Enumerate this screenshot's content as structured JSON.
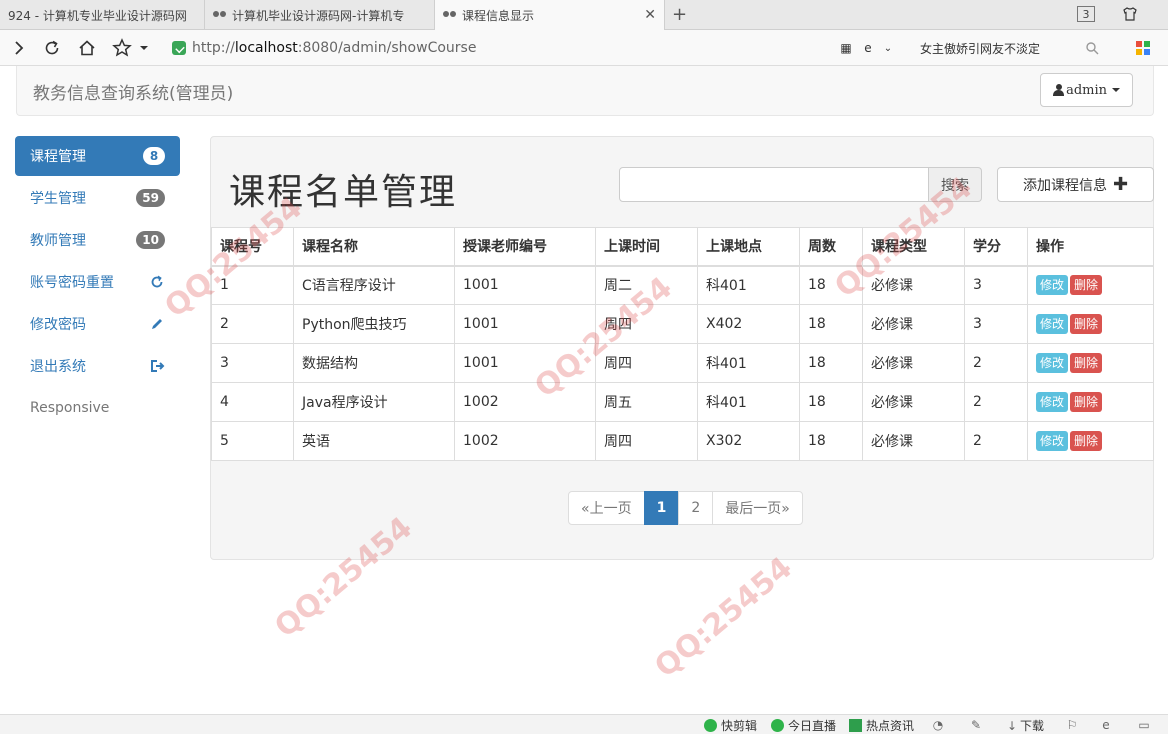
{
  "browser": {
    "tabs": [
      {
        "label": "924 - 计算机专业毕业设计源码网"
      },
      {
        "label": "计算机毕业设计源码网-计算机专"
      },
      {
        "label": "课程信息显示"
      }
    ],
    "tab_count": "3",
    "url_prefix": "http://",
    "url_host": "localhost",
    "url_rest": ":8080/admin/showCourse",
    "news_text": "女主傲娇引网友不淡定"
  },
  "header": {
    "brand": "教务信息查询系统(管理员)",
    "user": "admin"
  },
  "sidebar": {
    "items": [
      {
        "label": "课程管理",
        "badge": "8"
      },
      {
        "label": "学生管理",
        "badge": "59"
      },
      {
        "label": "教师管理",
        "badge": "10"
      },
      {
        "label": "账号密码重置",
        "icon": "refresh-icon"
      },
      {
        "label": "修改密码",
        "icon": "pencil-icon"
      },
      {
        "label": "退出系统",
        "icon": "logout-icon"
      },
      {
        "label": "Responsive"
      }
    ]
  },
  "main": {
    "title": "课程名单管理",
    "search_value": "",
    "search_button": "搜索",
    "add_button": "添加课程信息",
    "table": {
      "headers": [
        "课程号",
        "课程名称",
        "授课老师编号",
        "上课时间",
        "上课地点",
        "周数",
        "课程类型",
        "学分",
        "操作"
      ],
      "rows": [
        [
          "1",
          "C语言程序设计",
          "1001",
          "周二",
          "科401",
          "18",
          "必修课",
          "3"
        ],
        [
          "2",
          "Python爬虫技巧",
          "1001",
          "周四",
          "X402",
          "18",
          "必修课",
          "3"
        ],
        [
          "3",
          "数据结构",
          "1001",
          "周四",
          "科401",
          "18",
          "必修课",
          "2"
        ],
        [
          "4",
          "Java程序设计",
          "1002",
          "周五",
          "科401",
          "18",
          "必修课",
          "2"
        ],
        [
          "5",
          "英语",
          "1002",
          "周四",
          "X302",
          "18",
          "必修课",
          "2"
        ]
      ],
      "edit_label": "修改",
      "delete_label": "删除"
    },
    "pagination": {
      "prev": "«上一页",
      "pages": [
        "1",
        "2"
      ],
      "current": "1",
      "last": "最后一页»"
    }
  },
  "statusbar": {
    "items": [
      "快剪辑",
      "今日直播",
      "热点资讯",
      "下载"
    ]
  },
  "colors": {
    "primary": "#337ab7",
    "edit": "#5bc0de",
    "delete": "#d9534f"
  }
}
